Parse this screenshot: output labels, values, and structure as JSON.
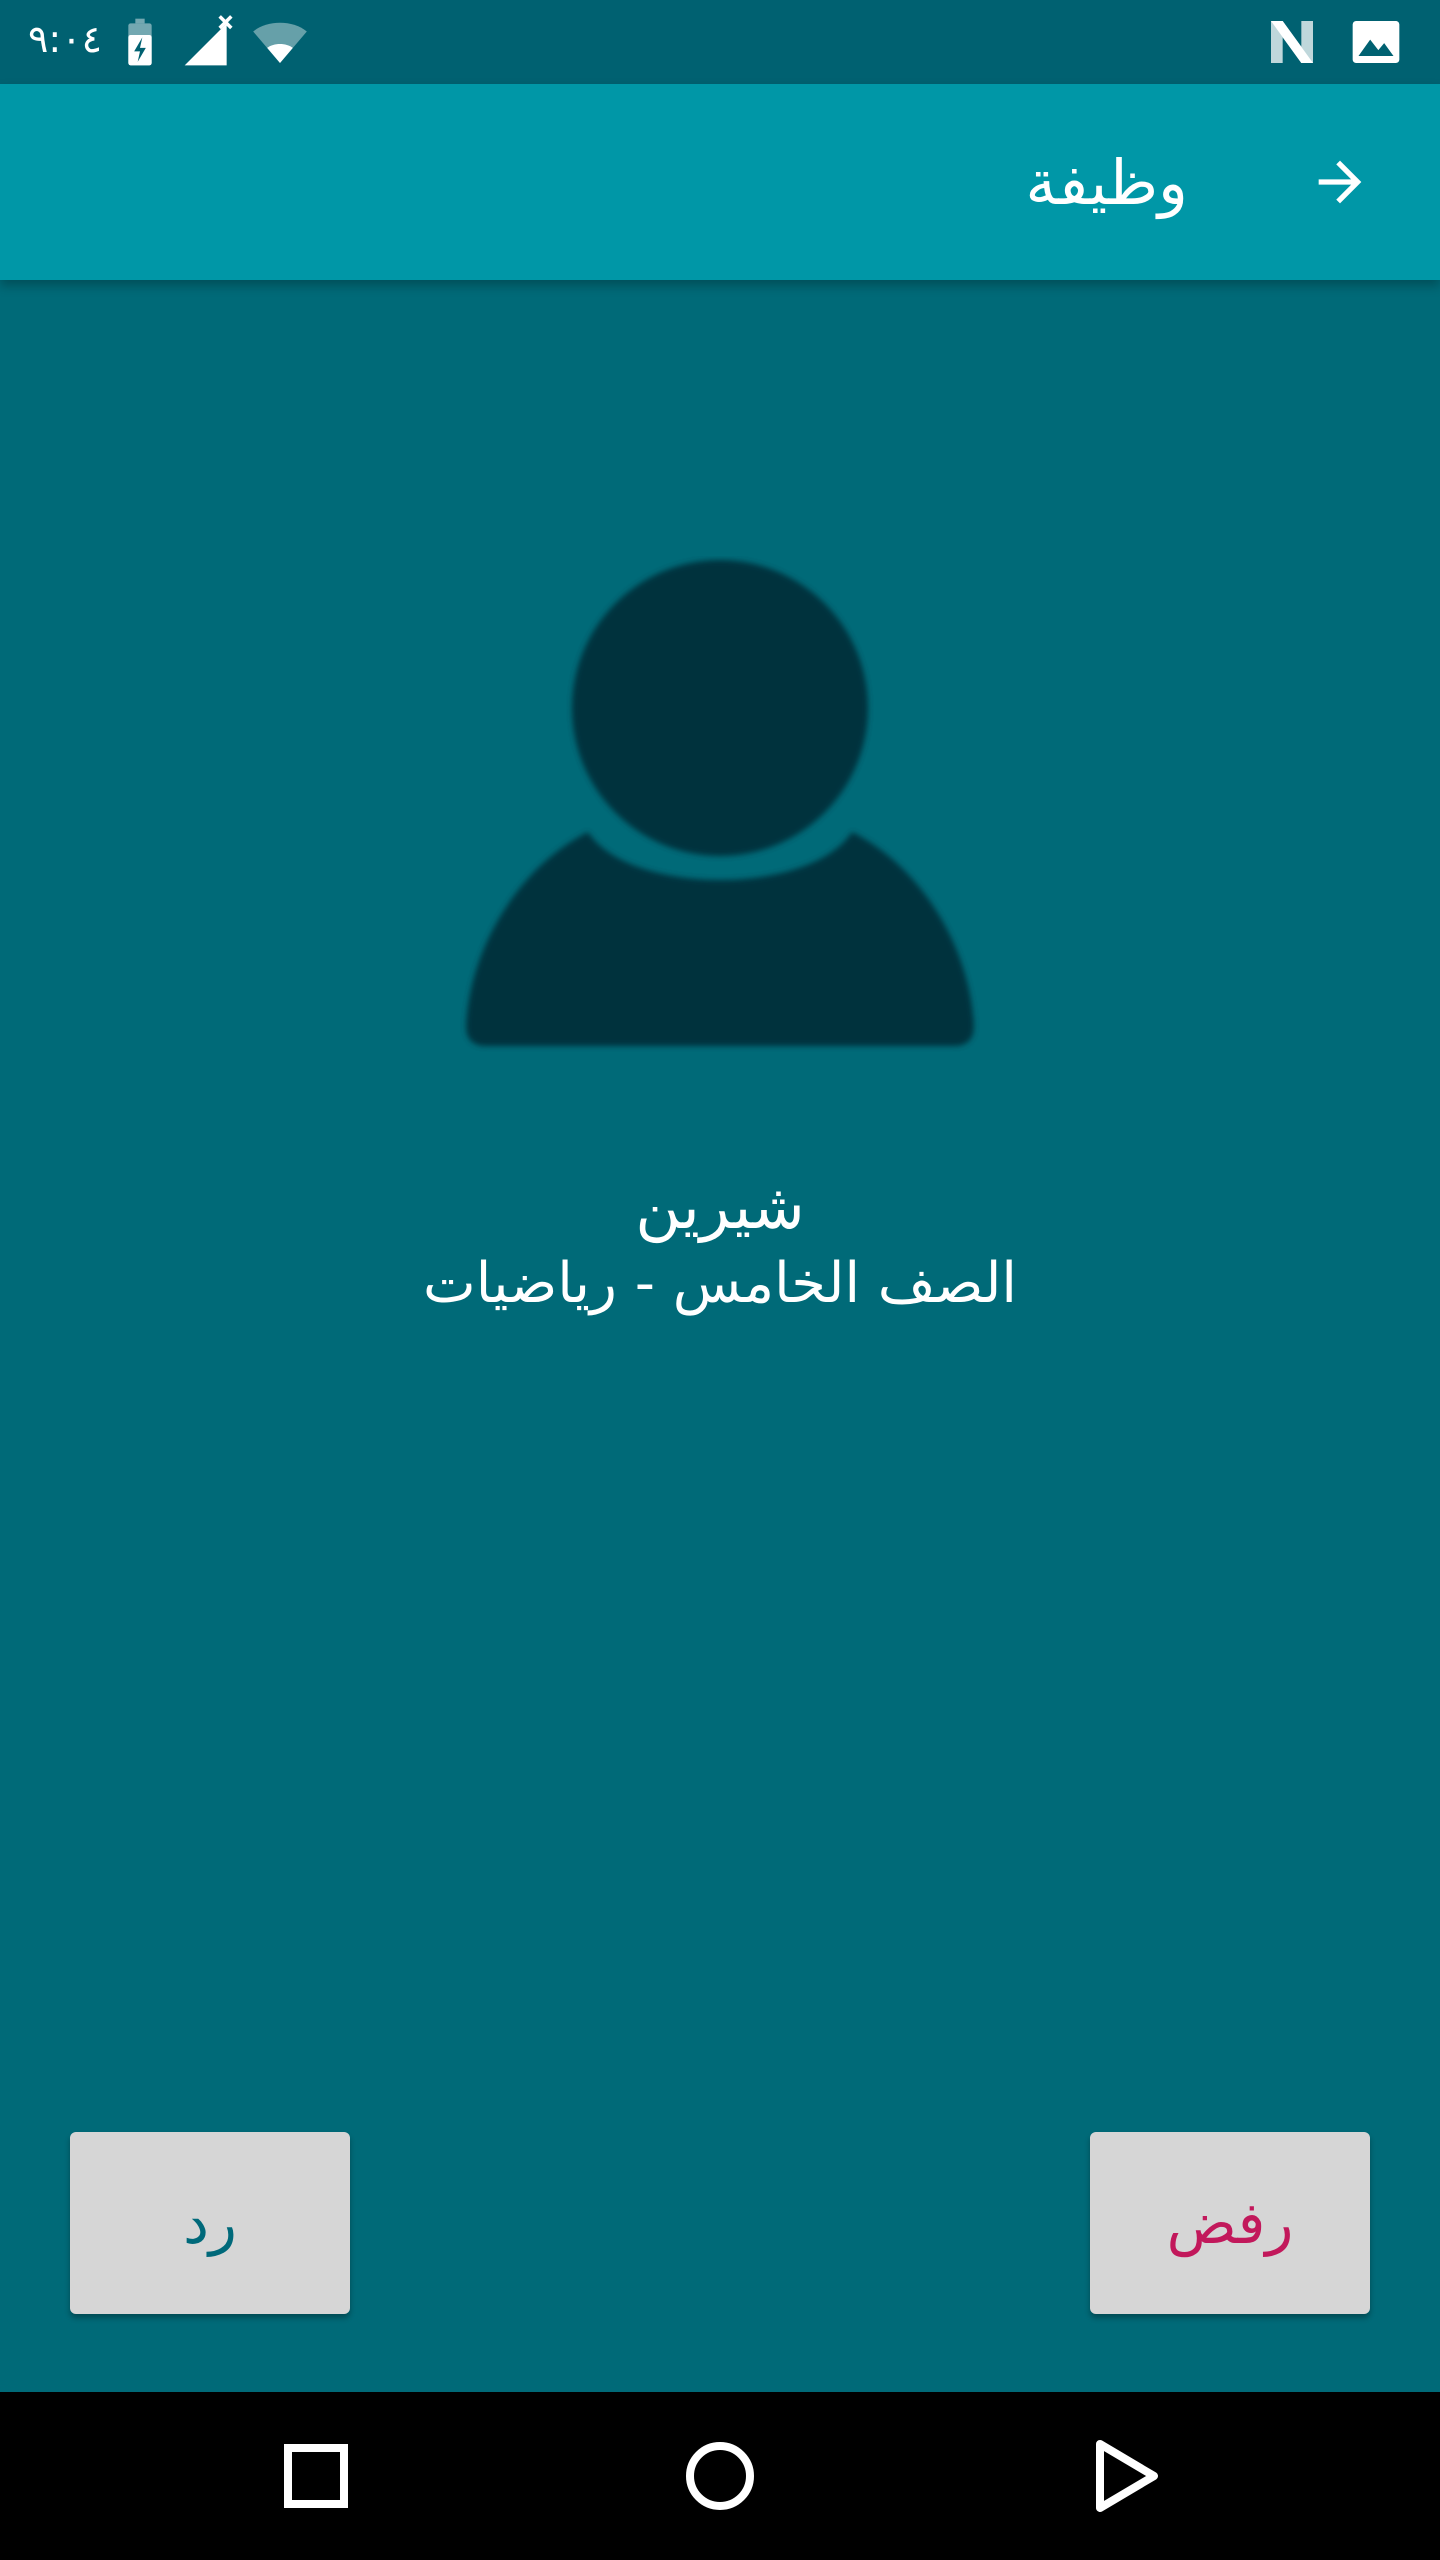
{
  "status_bar": {
    "time": "٩:٠٤",
    "icons": [
      "battery-charging-icon",
      "signal-no-service-icon",
      "wifi-icon",
      "n-notification-icon",
      "image-notification-icon"
    ]
  },
  "app_bar": {
    "title": "وظيفة",
    "back_icon": "arrow-right-icon"
  },
  "contact": {
    "avatar_icon": "person-placeholder-icon",
    "name": "شيرين",
    "subtitle": "الصف الخامس - رياضيات"
  },
  "actions": {
    "reply_label": "رد",
    "reject_label": "رفض"
  },
  "nav_bar": {
    "icons": [
      "recent-apps-icon",
      "home-icon",
      "back-icon"
    ]
  },
  "colors": {
    "background": "#006A78",
    "status_bar": "#006171",
    "app_bar": "#0097A7",
    "avatar": "#00333D",
    "button_bg": "#D6D6D6",
    "reply_text": "#00697A",
    "reject_text": "#C2185B"
  }
}
